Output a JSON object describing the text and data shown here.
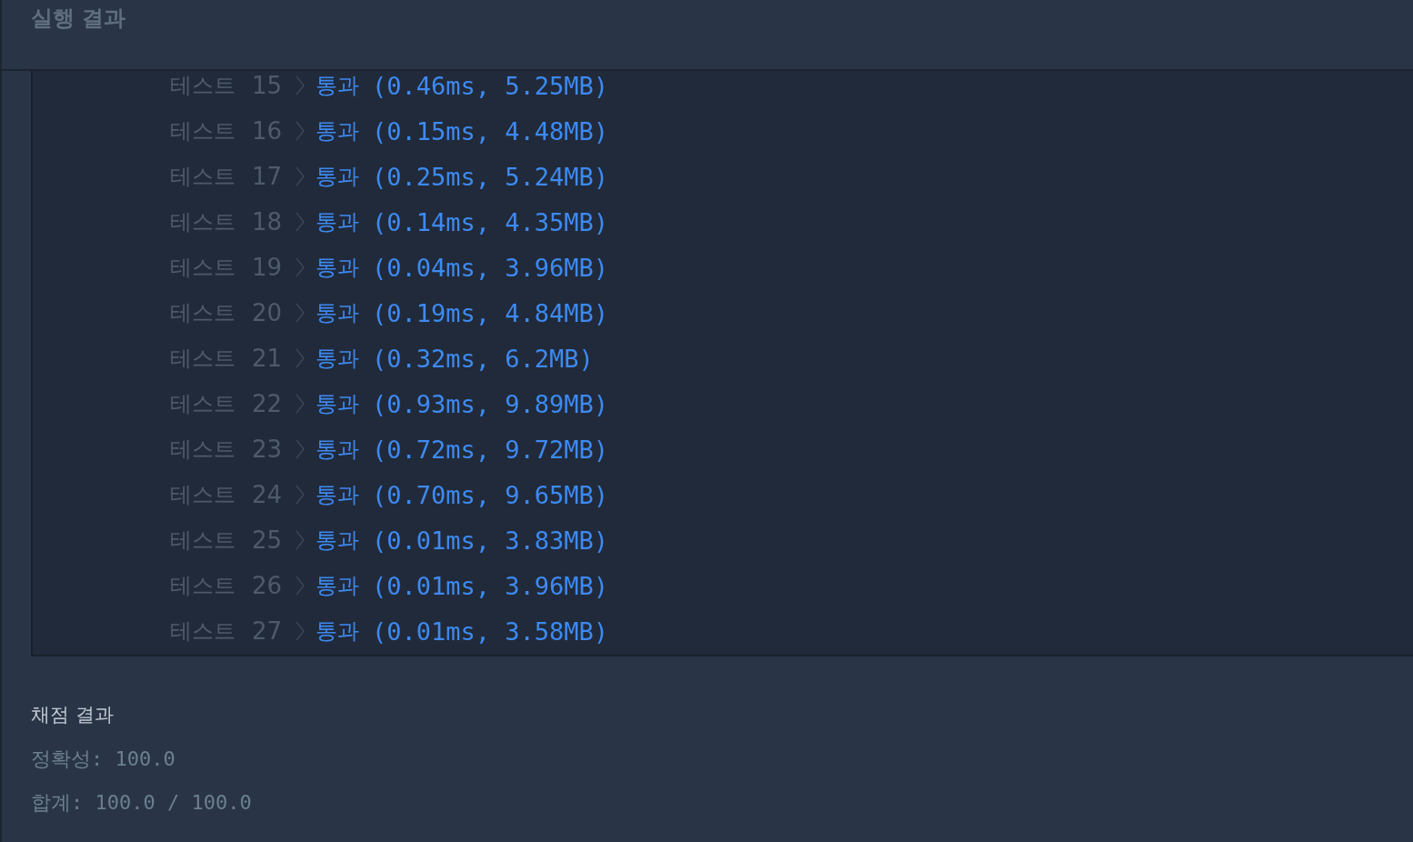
{
  "header": {
    "title": "실행 결과"
  },
  "tests": [
    {
      "label": "테스트",
      "number": "15",
      "status": "통과",
      "result": "(0.46ms, 5.25MB)"
    },
    {
      "label": "테스트",
      "number": "16",
      "status": "통과",
      "result": "(0.15ms, 4.48MB)"
    },
    {
      "label": "테스트",
      "number": "17",
      "status": "통과",
      "result": "(0.25ms, 5.24MB)"
    },
    {
      "label": "테스트",
      "number": "18",
      "status": "통과",
      "result": "(0.14ms, 4.35MB)"
    },
    {
      "label": "테스트",
      "number": "19",
      "status": "통과",
      "result": "(0.04ms, 3.96MB)"
    },
    {
      "label": "테스트",
      "number": "20",
      "status": "통과",
      "result": "(0.19ms, 4.84MB)"
    },
    {
      "label": "테스트",
      "number": "21",
      "status": "통과",
      "result": "(0.32ms, 6.2MB)"
    },
    {
      "label": "테스트",
      "number": "22",
      "status": "통과",
      "result": "(0.93ms, 9.89MB)"
    },
    {
      "label": "테스트",
      "number": "23",
      "status": "통과",
      "result": "(0.72ms, 9.72MB)"
    },
    {
      "label": "테스트",
      "number": "24",
      "status": "통과",
      "result": "(0.70ms, 9.65MB)"
    },
    {
      "label": "테스트",
      "number": "25",
      "status": "통과",
      "result": "(0.01ms, 3.83MB)"
    },
    {
      "label": "테스트",
      "number": "26",
      "status": "통과",
      "result": "(0.01ms, 3.96MB)"
    },
    {
      "label": "테스트",
      "number": "27",
      "status": "통과",
      "result": "(0.01ms, 3.58MB)"
    }
  ],
  "grading": {
    "title": "채점 결과",
    "accuracy": "정확성: 100.0",
    "total": "합계: 100.0 / 100.0"
  }
}
